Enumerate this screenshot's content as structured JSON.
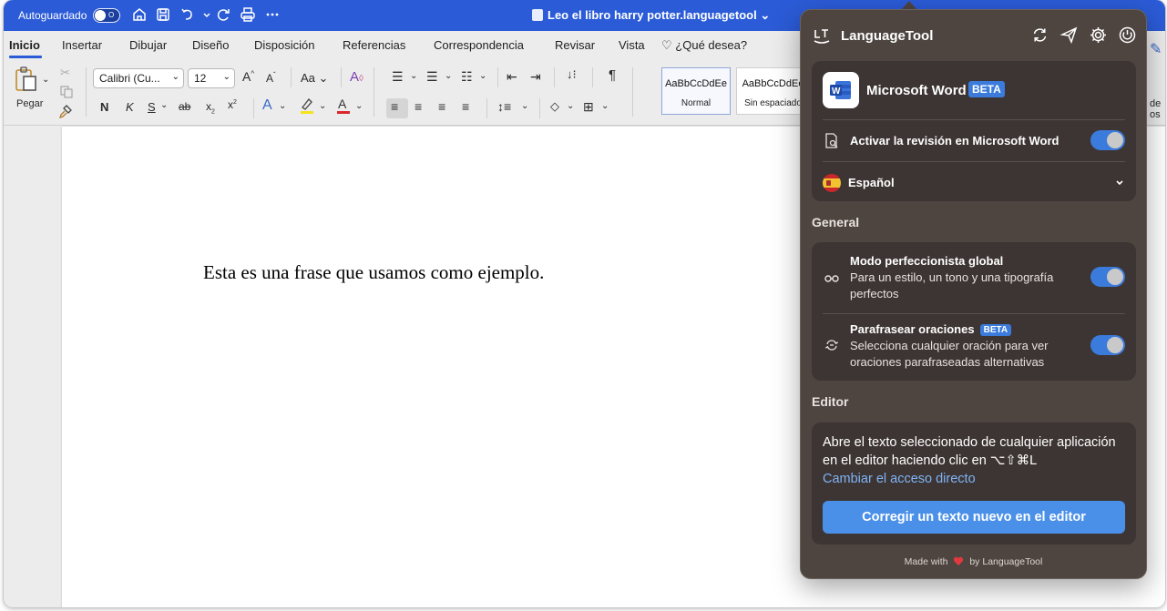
{
  "titlebar": {
    "autosave_label": "Autoguardado",
    "autosave_state": "O",
    "document_title": "Leo el libro harry potter.languagetool"
  },
  "ribbon_tabs": [
    "Inicio",
    "Insertar",
    "Dibujar",
    "Diseño",
    "Disposición",
    "Referencias",
    "Correspondencia",
    "Revisar",
    "Vista"
  ],
  "tell_me": "¿Qué desea?",
  "ribbon": {
    "paste_label": "Pegar",
    "font_name": "Calibri (Cu...",
    "font_size": "12",
    "case_label": "Aa",
    "bold": "N",
    "italic": "K",
    "underline": "S",
    "strike": "ab",
    "subscript": "x",
    "superscript": "x",
    "styles": [
      {
        "sample": "AaBbCcDdEe",
        "name": "Normal"
      },
      {
        "sample": "AaBbCcDdEe",
        "name": "Sin espaciado"
      }
    ],
    "edge_label_1": "de",
    "edge_label_2": "os"
  },
  "document": {
    "text": "Esta es una frase que usamos como ejemplo."
  },
  "languagetool": {
    "title": "LanguageTool",
    "app_name": "Microsoft Word",
    "beta_label": "BETA",
    "activate_label": "Activar la revisión en Microsoft Word",
    "language": "Español",
    "general_title": "General",
    "perfectionist_title": "Modo perfeccionista global",
    "perfectionist_desc": "Para un estilo, un tono y una tipografía perfectos",
    "paraphrase_title": "Parafrasear oraciones",
    "paraphrase_beta": "BETA",
    "paraphrase_desc": "Selecciona cualquier oración para ver oraciones parafraseadas alternativas",
    "editor_title": "Editor",
    "editor_text": "Abre el texto seleccionado de cualquier aplicación en el editor haciendo clic en ⌥⇧⌘L",
    "editor_link": "Cambiar el acceso directo",
    "editor_button": "Corregir un texto nuevo en el editor",
    "footer_made": "Made with",
    "footer_by": "by LanguageTool",
    "colors": {
      "panel_bg": "#4e4541",
      "card_bg": "#3d3533",
      "accent": "#3a7bdc",
      "link": "#7fb3f5"
    }
  }
}
